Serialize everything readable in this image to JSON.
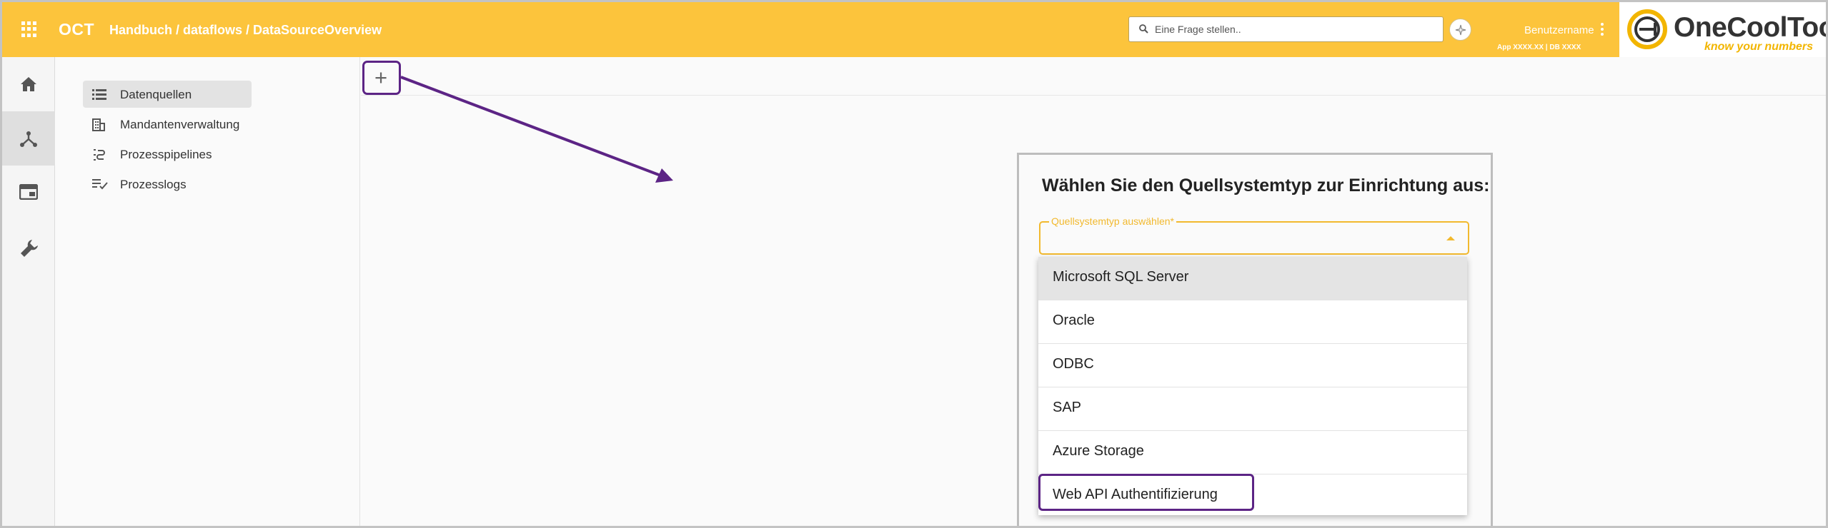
{
  "header": {
    "app_name": "OCT",
    "breadcrumb": "Handbuch / dataflows / DataSourceOverview",
    "search_placeholder": "Eine Frage stellen..",
    "username": "Benutzername",
    "version": "App XXXX.XX | DB XXXX",
    "logo_text": "OneCoolTool",
    "logo_tagline": "know your numbers",
    "accent_color": "#fcc43c"
  },
  "rail": {
    "items": [
      {
        "icon": "home-icon"
      },
      {
        "icon": "dataflow-icon",
        "active": true
      },
      {
        "icon": "window-icon"
      },
      {
        "icon": "wrench-icon"
      }
    ]
  },
  "sidebar": {
    "items": [
      {
        "label": "Datenquellen",
        "icon": "list-icon",
        "active": true
      },
      {
        "label": "Mandantenverwaltung",
        "icon": "building-icon"
      },
      {
        "label": "Prozesspipelines",
        "icon": "pipeline-icon"
      },
      {
        "label": "Prozesslogs",
        "icon": "checklist-icon"
      }
    ]
  },
  "main": {
    "add_label": "+",
    "dialog": {
      "title": "Wählen Sie den Quellsystemtyp zur Einrichtung aus:",
      "select_label": "Quellsystemtyp auswählen*",
      "options": [
        "Microsoft SQL Server",
        "Oracle",
        "ODBC",
        "SAP",
        "Azure Storage",
        "Web API Authentifizierung"
      ]
    }
  },
  "annotation_color": "#5c2485"
}
